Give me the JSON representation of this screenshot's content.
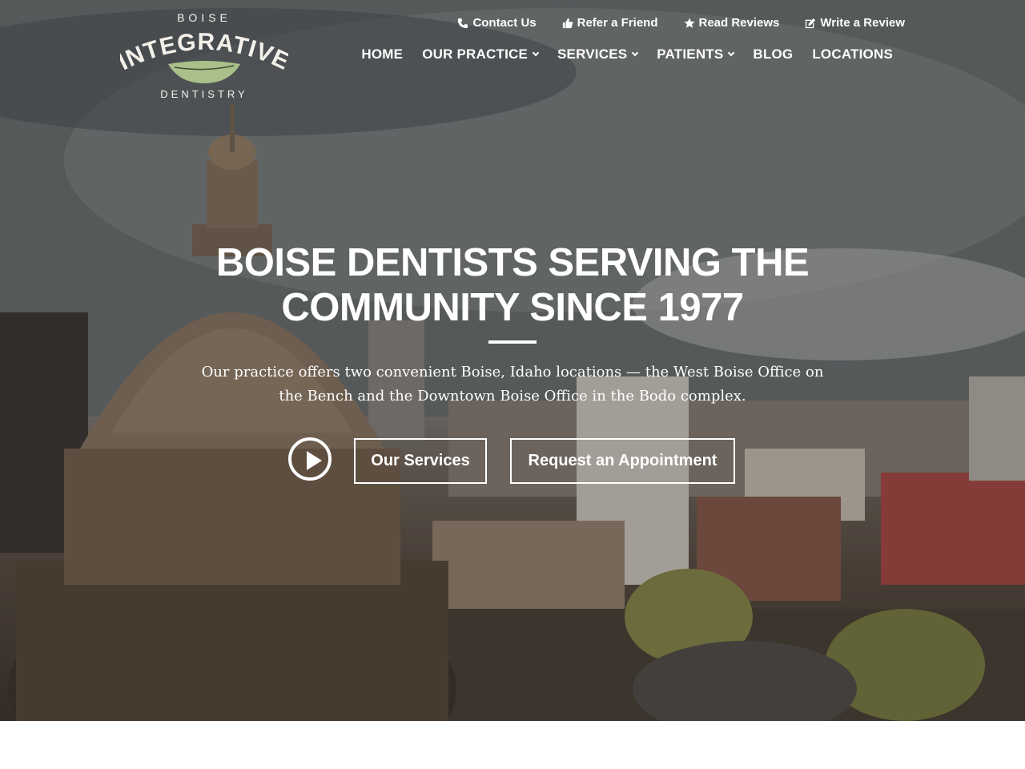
{
  "logo": {
    "top_text": "BOISE",
    "main_text": "INTEGRATIVE",
    "bottom_text": "DENTISTRY",
    "leaf_color": "#a9c08a"
  },
  "utility_nav": [
    {
      "label": "Contact Us",
      "icon": "phone-icon"
    },
    {
      "label": "Refer a Friend",
      "icon": "thumbs-up-icon"
    },
    {
      "label": "Read Reviews",
      "icon": "star-icon"
    },
    {
      "label": "Write a Review",
      "icon": "edit-icon"
    }
  ],
  "main_nav": [
    {
      "label": "HOME",
      "has_dropdown": false
    },
    {
      "label": "OUR PRACTICE",
      "has_dropdown": true
    },
    {
      "label": "SERVICES",
      "has_dropdown": true
    },
    {
      "label": "PATIENTS",
      "has_dropdown": true
    },
    {
      "label": "BLOG",
      "has_dropdown": false
    },
    {
      "label": "LOCATIONS",
      "has_dropdown": false
    }
  ],
  "hero": {
    "headline_line1": "BOISE DENTISTS SERVING THE",
    "headline_line2": "COMMUNITY SINCE 1977",
    "subtext": "Our practice offers two convenient Boise, Idaho locations — the West Boise Office on the Bench and the Downtown Boise Office in the Bodo complex.",
    "cta_services": "Our Services",
    "cta_appointment": "Request an Appointment"
  },
  "colors": {
    "text": "#ffffff",
    "page_background": "#ffffff"
  }
}
